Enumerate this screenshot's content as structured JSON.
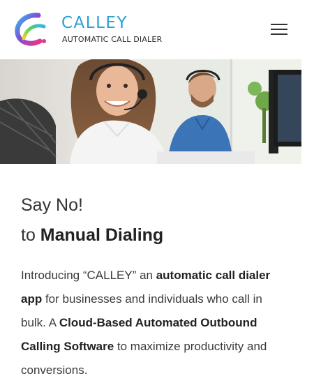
{
  "header": {
    "brand_name": "CALLEY",
    "brand_tagline": "AUTOMATIC CALL DIALER",
    "menu_icon": "hamburger-menu-icon"
  },
  "hero": {
    "image_subject": "call-center-agents-photo"
  },
  "main": {
    "headline_line1": "Say No!",
    "headline_line2_prefix": "to ",
    "headline_line2_bold": "Manual Dialing",
    "intro": [
      {
        "text": "Introducing “CALLEY” an ",
        "bold": false
      },
      {
        "text": "automatic call dialer app",
        "bold": true
      },
      {
        "text": " for businesses and individuals who call in bulk. A ",
        "bold": false
      },
      {
        "text": "Cloud-Based Automated Outbound Calling Software",
        "bold": true
      },
      {
        "text": " to maximize productivity and conversions.",
        "bold": false
      }
    ]
  },
  "colors": {
    "brand_blue": "#2d9fd6",
    "text_dark": "#333333"
  }
}
